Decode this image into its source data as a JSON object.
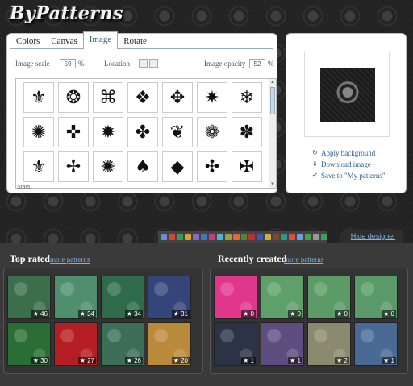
{
  "app": {
    "logo": "ByPatterns"
  },
  "designer": {
    "tabs": [
      "Colors",
      "Canvas",
      "Image",
      "Rotate"
    ],
    "active_tab": "Image",
    "image_scale_label": "Image scale",
    "image_scale_value": "59",
    "image_scale_unit": "%",
    "location_label": "Location",
    "opacity_label": "Image opacity",
    "opacity_value": "52",
    "opacity_unit": "%",
    "glyph_footer": "Stars"
  },
  "preview": {
    "links": [
      {
        "label": "Apply background",
        "icon": "refresh-icon"
      },
      {
        "label": "Download image",
        "icon": "download-arrow-icon"
      },
      {
        "label": "Save to \"My patterns\"",
        "icon": "checkmark-icon"
      }
    ]
  },
  "toolbar": {
    "hide_label": "Hide designer"
  },
  "top_rated": {
    "title": "Top rated",
    "more": "more patterns",
    "items": [
      {
        "color": "#3d6e4c",
        "count": "46"
      },
      {
        "color": "#4f8f6e",
        "count": "34"
      },
      {
        "color": "#2f6b4a",
        "count": "34"
      },
      {
        "color": "#34457a",
        "count": "31"
      },
      {
        "color": "#2a6e35",
        "count": "30"
      },
      {
        "color": "#b51e22",
        "count": "27"
      },
      {
        "color": "#3c6e58",
        "count": "26"
      },
      {
        "color": "#b88a3a",
        "count": "20"
      }
    ]
  },
  "recent": {
    "title": "Recently created",
    "more": "more patterns",
    "items": [
      {
        "color": "#e0368c",
        "count": "0"
      },
      {
        "color": "#5f9f6a",
        "count": "0"
      },
      {
        "color": "#5c9a66",
        "count": "0"
      },
      {
        "color": "#5a9a68",
        "count": "0"
      },
      {
        "color": "#2a3446",
        "count": "1"
      },
      {
        "color": "#5e4e80",
        "count": "1"
      },
      {
        "color": "#8b8a6e",
        "count": "2"
      },
      {
        "color": "#4a6a96",
        "count": "1"
      }
    ]
  }
}
